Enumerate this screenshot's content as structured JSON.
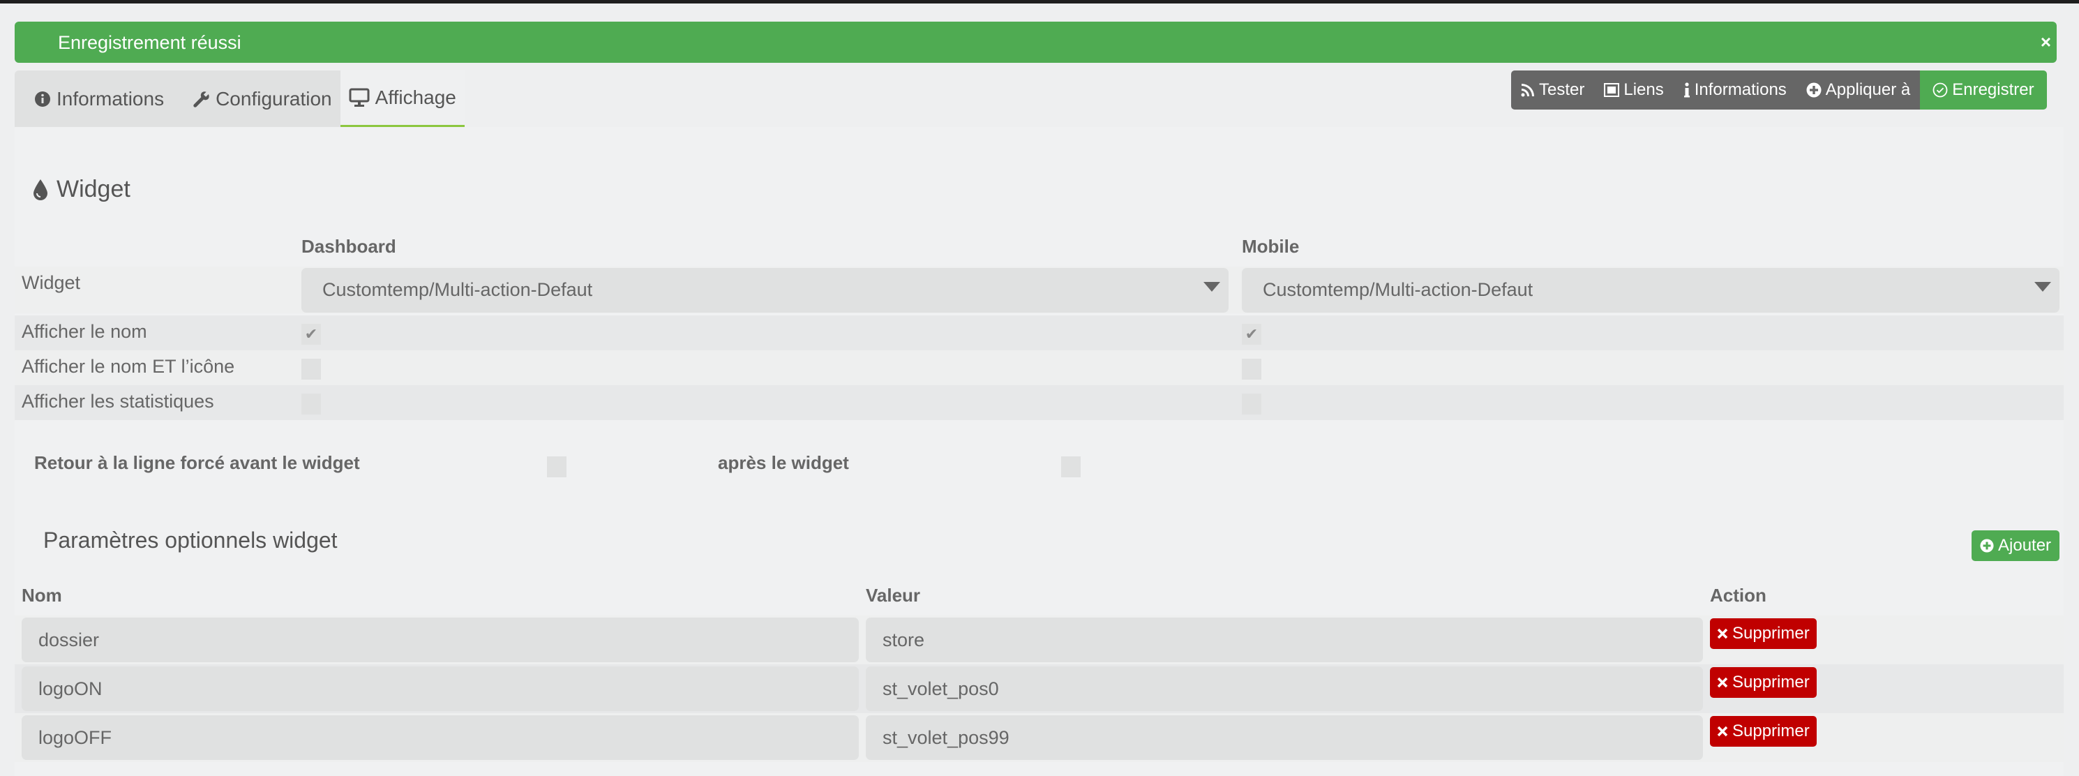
{
  "alert": {
    "message": "Enregistrement réussi",
    "close_icon": "×",
    "color": "#4fab52"
  },
  "tabs": [
    {
      "label": "Informations",
      "icon": "info-circle-icon",
      "active": false
    },
    {
      "label": "Configuration",
      "icon": "wrench-icon",
      "active": false
    },
    {
      "label": "Affichage",
      "icon": "desktop-icon",
      "active": true
    }
  ],
  "toolbar": {
    "buttons": [
      {
        "label": "Tester",
        "icon": "rss-icon"
      },
      {
        "label": "Liens",
        "icon": "object-group-icon"
      },
      {
        "label": "Informations",
        "icon": "info-icon"
      },
      {
        "label": "Appliquer à",
        "icon": "plus-circle-icon"
      },
      {
        "label": "Enregistrer",
        "icon": "check-circle-icon"
      }
    ]
  },
  "widget_section": {
    "title": "Widget",
    "icon": "tint-icon",
    "columns": [
      "Dashboard",
      "Mobile"
    ],
    "rows": [
      {
        "label": "Widget",
        "dashboard": "Customtemp/Multi-action-Defaut",
        "mobile": "Customtemp/Multi-action-Defaut"
      },
      {
        "label": "Afficher le nom",
        "dashboard": true,
        "mobile": true
      },
      {
        "label": "Afficher le nom ET l’icône",
        "dashboard": false,
        "mobile": false
      },
      {
        "label": "Afficher les statistiques",
        "dashboard": false,
        "mobile": false
      }
    ],
    "check_glyph": "✔",
    "line_break_before_label": "Retour à la ligne forcé avant le widget",
    "line_break_before": false,
    "line_break_after_label": "après le widget",
    "line_break_after": false
  },
  "optional_params": {
    "title": "Paramètres optionnels widget",
    "add_label": "Ajouter",
    "columns": [
      "Nom",
      "Valeur",
      "Action"
    ],
    "delete_label": "Supprimer",
    "rows": [
      {
        "name": "dossier",
        "value": "store"
      },
      {
        "name": "logoON",
        "value": "st_volet_pos0"
      },
      {
        "name": "logoOFF",
        "value": "st_volet_pos99"
      }
    ]
  }
}
